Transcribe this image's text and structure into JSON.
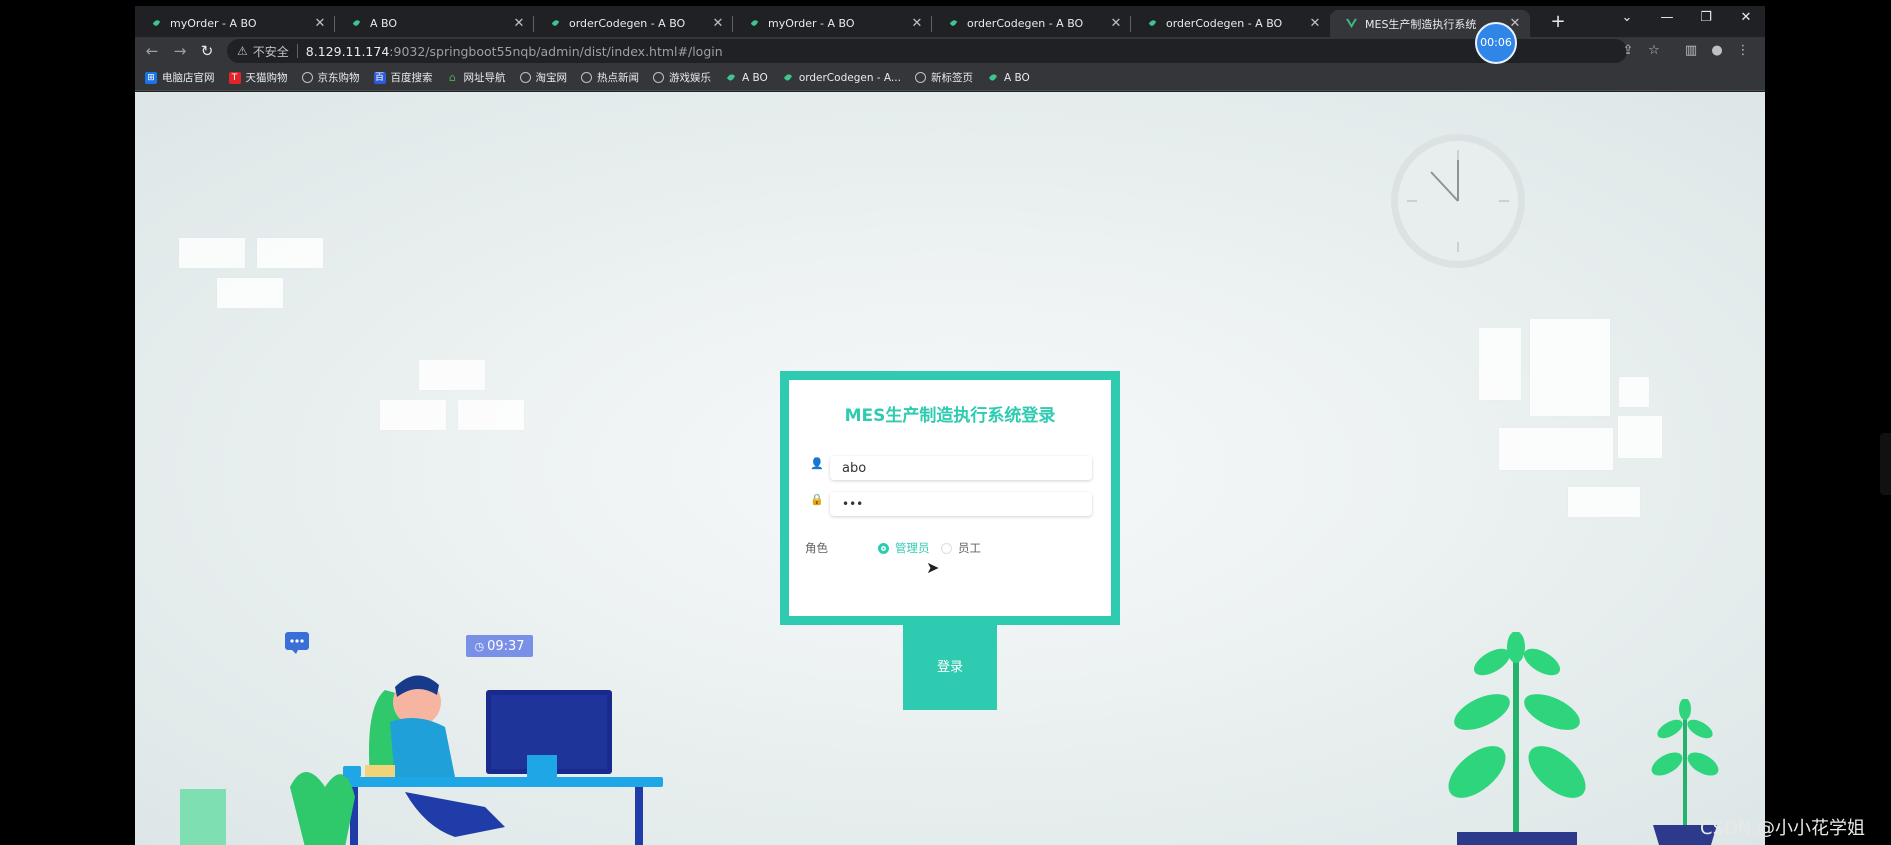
{
  "tabs": [
    {
      "title": "myOrder - A BO"
    },
    {
      "title": "A BO"
    },
    {
      "title": "orderCodegen - A BO"
    },
    {
      "title": "myOrder - A BO"
    },
    {
      "title": "orderCodegen - A BO"
    },
    {
      "title": "orderCodegen - A BO"
    },
    {
      "title": "MES生产制造执行系统"
    }
  ],
  "timer": "00:06",
  "address": {
    "security_label": "不安全",
    "host": "8.129.11.174",
    "path": ":9032/springboot55nqb/admin/dist/index.html#/login"
  },
  "bookmarks": [
    {
      "label": "电脑店官网"
    },
    {
      "label": "天猫购物"
    },
    {
      "label": "京东购物"
    },
    {
      "label": "百度搜索"
    },
    {
      "label": "网址导航"
    },
    {
      "label": "淘宝网"
    },
    {
      "label": "热点新闻"
    },
    {
      "label": "游戏娱乐"
    },
    {
      "label": "A BO"
    },
    {
      "label": "orderCodegen - A..."
    },
    {
      "label": "新标签页"
    },
    {
      "label": "A BO"
    }
  ],
  "login": {
    "title": "MES生产制造执行系统登录",
    "username_value": "abo",
    "password_value": "•••",
    "role_label": "角色",
    "roles": [
      {
        "label": "管理员",
        "selected": true
      },
      {
        "label": "员工",
        "selected": false
      }
    ],
    "submit_label": "登录"
  },
  "illustration": {
    "monitor_time": "09:37"
  },
  "watermark": "CSDN @小小花学姐",
  "colors": {
    "accent": "#2fcbb1",
    "timer": "#2f86e6"
  }
}
